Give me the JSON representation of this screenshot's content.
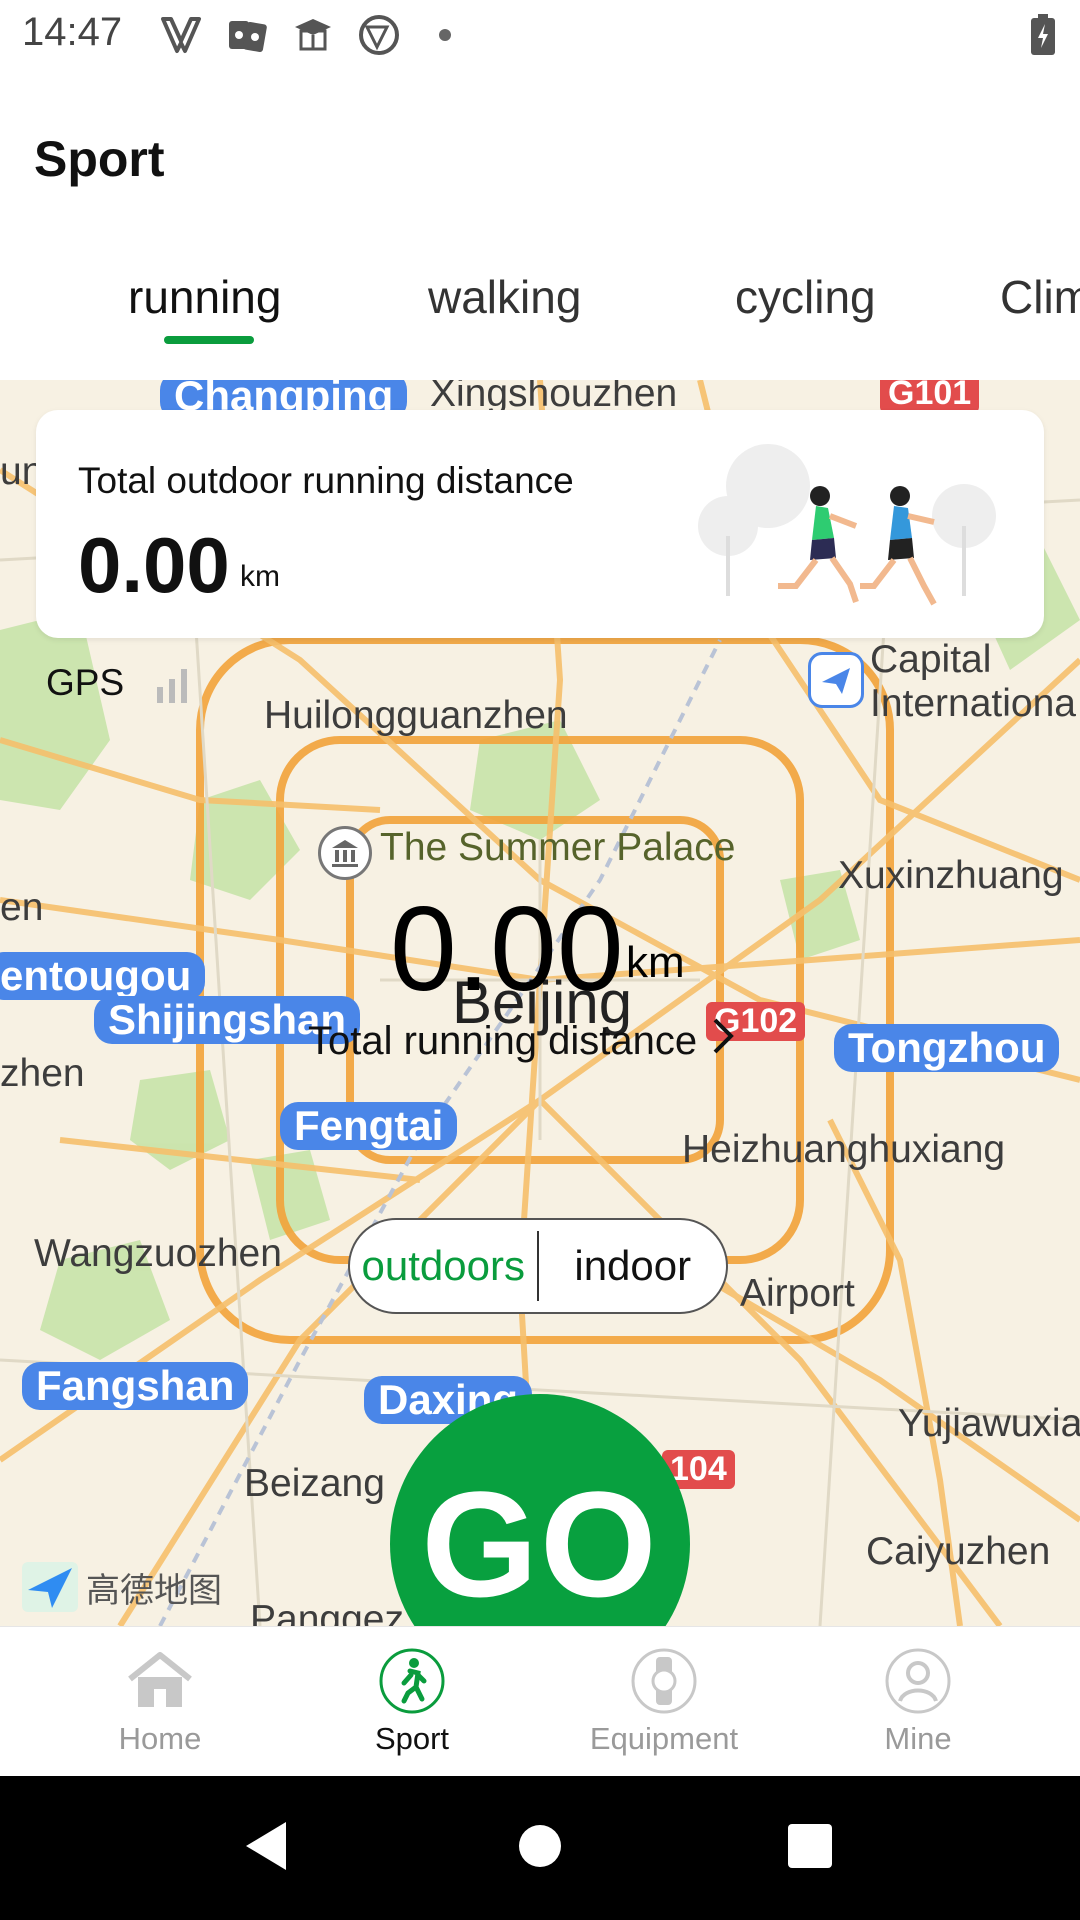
{
  "status_bar": {
    "time": "14:47",
    "icons": [
      "vine-icon",
      "cards-icon",
      "graduation-cap-icon",
      "aperture-icon",
      "dot-icon",
      "battery-charging-icon"
    ]
  },
  "header": {
    "title": "Sport"
  },
  "tabs": [
    {
      "label": "running",
      "active": true
    },
    {
      "label": "walking",
      "active": false
    },
    {
      "label": "cycling",
      "active": false
    },
    {
      "label": "Clim",
      "active": false
    }
  ],
  "summary": {
    "label": "Total outdoor running distance",
    "value": "0.00",
    "unit": "km"
  },
  "gps": {
    "label": "GPS"
  },
  "total": {
    "value": "0.00",
    "unit": "km",
    "link_label": "Total running distance"
  },
  "modes": {
    "outdoors": "outdoors",
    "indoor": "indoor",
    "selected": "outdoors"
  },
  "go_button": {
    "label": "GO"
  },
  "map": {
    "provider_label": "高德地图",
    "labels": {
      "changping": "Changping",
      "xingshouzhen": "Xingshouzhen",
      "g101": "G101",
      "un": "un",
      "capital": "Capital",
      "international": "Internationa",
      "huilongguanzhen": "Huilongguanzhen",
      "summer_palace": "The Summer Palace",
      "xuxinzhuang": "Xuxinzhuang",
      "en": "en",
      "mentougou": "entougou",
      "shijingshan": "Shijingshan",
      "beijing": "Beijing",
      "g102": "G102",
      "tongzhou": "Tongzhou",
      "zhen": "zhen",
      "fengtai": "Fengtai",
      "heizhuanghuxiang": "Heizhuanghuxiang",
      "wangzuozhen": "Wangzuozhen",
      "airport": "Airport",
      "fangshan": "Fangshan",
      "daxing": "Daxing",
      "yujiawu": "Yujiawuxia",
      "g104": "104",
      "beizang": "Beizang",
      "caiyuzhen": "Caiyuzhen",
      "panggezhuang": "Panggez"
    }
  },
  "bottom_nav": [
    {
      "label": "Home",
      "icon": "home-icon",
      "active": false
    },
    {
      "label": "Sport",
      "icon": "runner-icon",
      "active": true
    },
    {
      "label": "Equipment",
      "icon": "watch-icon",
      "active": false
    },
    {
      "label": "Mine",
      "icon": "user-icon",
      "active": false
    }
  ],
  "colors": {
    "accent": "#0a9c3d",
    "go": "#08a03f"
  }
}
